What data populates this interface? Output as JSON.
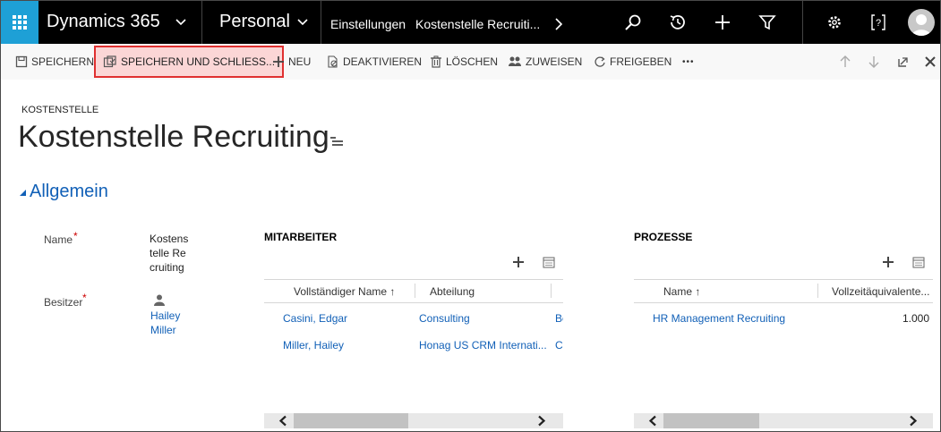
{
  "nav": {
    "brand": "Dynamics 365",
    "area": "Personal",
    "breadcrumb_settings": "Einstellungen",
    "breadcrumb_record": "Kostenstelle Recruiti..."
  },
  "commands": {
    "save": "SPEICHERN",
    "save_close": "SPEICHERN UND SCHLIEß...",
    "new": "NEU",
    "deactivate": "DEAKTIVIEREN",
    "delete": "LÖSCHEN",
    "assign": "ZUWEISEN",
    "share": "FREIGEBEN",
    "more": "•••"
  },
  "header": {
    "entity": "KOSTENSTELLE",
    "title": "Kostenstelle Recruiting"
  },
  "section": {
    "title": "Allgemein",
    "name_label": "Name",
    "name_value": "Kostenstelle Recruiting",
    "owner_label": "Besitzer",
    "owner_value": "Hailey Miller",
    "required_marker": "*"
  },
  "employees_grid": {
    "title": "MITARBEITER",
    "columns": [
      "Vollständiger Name ↑",
      "Abteilung"
    ],
    "rows": [
      {
        "name": "Casini, Edgar",
        "department": "Consulting",
        "extra": "Be"
      },
      {
        "name": "Miller, Hailey",
        "department": "Honag US CRM Internati...",
        "extra": "C"
      }
    ]
  },
  "process_grid": {
    "title": "PROZESSE",
    "columns": [
      "Name ↑",
      "Vollzeitäquivalente..."
    ],
    "rows": [
      {
        "name": "HR Management Recruiting",
        "fte": "1.000"
      }
    ]
  },
  "colors": {
    "nav_bg": "#000000",
    "waffle_bg": "#1ea0d6",
    "link": "#1160b7",
    "highlight_border": "#e03030"
  }
}
